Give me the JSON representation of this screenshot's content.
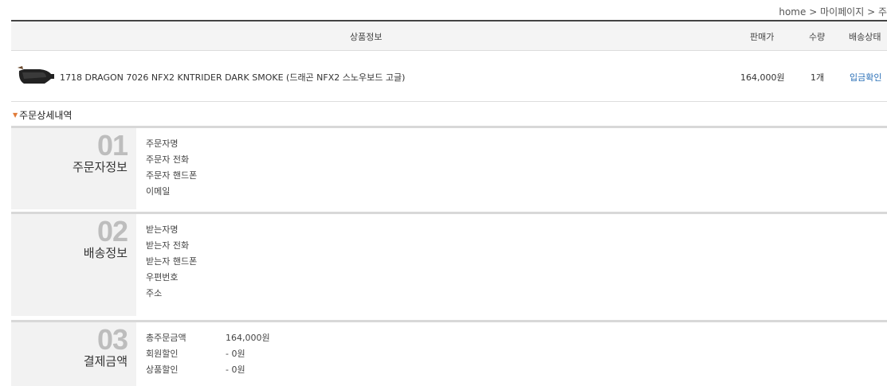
{
  "breadcrumb": "home > 마이페이지 > 주",
  "table_header": {
    "product": "상품정보",
    "price": "판매가",
    "qty": "수량",
    "status": "배송상태"
  },
  "product_row": {
    "name": "1718 DRAGON 7026 NFX2 KNTRIDER DARK SMOKE (드래곤 NFX2 스노우보드 고글)",
    "price": "164,000원",
    "qty": "1개",
    "status": "입금확인"
  },
  "section_title": "주문상세내역",
  "orderer": {
    "num": "01",
    "label": "주문자정보",
    "fields": [
      "주문자명",
      "주문자 전화",
      "주문자 핸드폰",
      "이메일"
    ]
  },
  "shipping": {
    "num": "02",
    "label": "배송정보",
    "fields": [
      "받는자명",
      "받는자 전화",
      "받는자 핸드폰",
      "우편번호",
      "주소"
    ]
  },
  "payment": {
    "num": "03",
    "label": "결제금액",
    "rows": [
      {
        "label": "총주문금액",
        "value": "164,000원"
      },
      {
        "label": "회원할인",
        "value": "- 0원"
      },
      {
        "label": "상품할인",
        "value": "- 0원"
      }
    ]
  }
}
